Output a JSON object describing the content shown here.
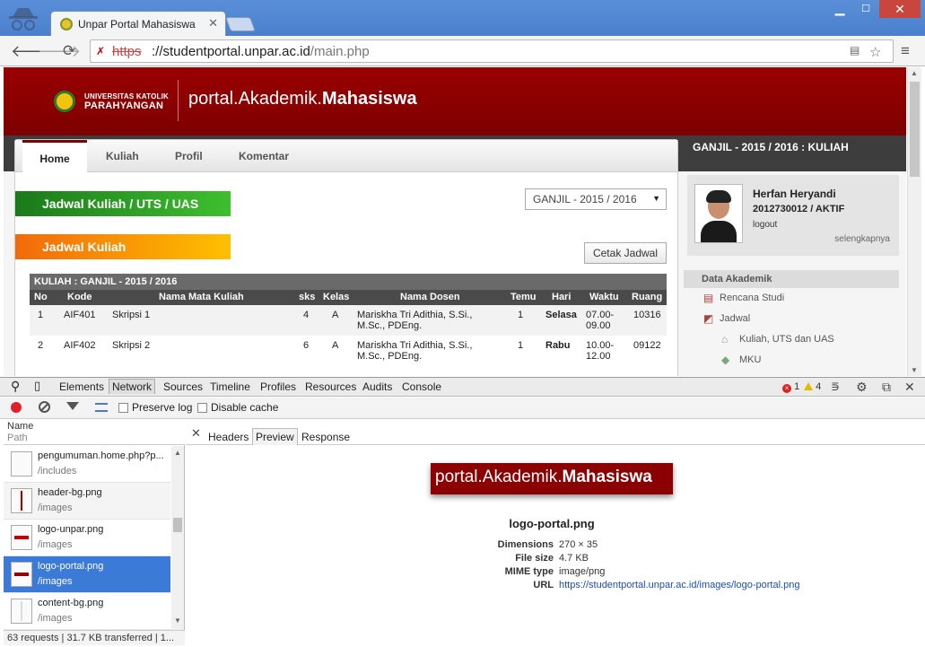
{
  "browser": {
    "tab_title": "Unpar Portal Mahasiswa",
    "url_protocol": "https",
    "url_host": "://studentportal.unpar.ac.id",
    "url_path": "/main.php"
  },
  "site": {
    "university_line1": "UNIVERSITAS KATOLIK",
    "university_line2": "PARAHYANGAN",
    "portal_title_prefix": "portal.Akademik.",
    "portal_title_bold": "Mahasiswa",
    "nav": [
      "Home",
      "Kuliah",
      "Profil",
      "Komentar"
    ],
    "section_green": "Jadwal Kuliah / UTS / UAS",
    "section_orange": "Jadwal Kuliah",
    "semester_select": "GANJIL - 2015 / 2016",
    "print_button": "Cetak Jadwal",
    "right_heading": "GANJIL - 2015 / 2016 : KULIAH",
    "schedule": {
      "caption": "KULIAH : GANJIL - 2015 / 2016",
      "columns": [
        "No",
        "Kode",
        "Nama Mata Kuliah",
        "sks",
        "Kelas",
        "Nama Dosen",
        "Temu",
        "Hari",
        "Waktu",
        "Ruang"
      ],
      "rows": [
        {
          "no": "1",
          "kode": "AIF401",
          "nama": "Skripsi 1",
          "sks": "4",
          "kelas": "A",
          "dosen1": "Mariskha Tri Adithia, S.Si.,",
          "dosen2": "M.Sc., PDEng.",
          "temu": "1",
          "hari": "Selasa",
          "waktu1": "07.00-",
          "waktu2": "09.00",
          "ruang": "10316"
        },
        {
          "no": "2",
          "kode": "AIF402",
          "nama": "Skripsi 2",
          "sks": "6",
          "kelas": "A",
          "dosen1": "Mariskha Tri Adithia, S.Si.,",
          "dosen2": "M.Sc., PDEng.",
          "temu": "1",
          "hari": "Rabu",
          "waktu1": "10.00-",
          "waktu2": "12.00",
          "ruang": "09122"
        }
      ]
    },
    "profile": {
      "name": "Herfan Heryandi",
      "id_status": "2012730012 / AKTIF",
      "logout": "logout",
      "more": "selengkapnya"
    },
    "side_menu": {
      "section": "Data Akademik",
      "items": [
        "Rencana Studi",
        "Jadwal"
      ],
      "subitems": [
        "Kuliah, UTS dan UAS",
        "MKU"
      ]
    }
  },
  "devtools": {
    "tabs": [
      "Elements",
      "Network",
      "Sources",
      "Timeline",
      "Profiles",
      "Resources",
      "Audits",
      "Console"
    ],
    "errors": "1",
    "warnings": "4",
    "preserve_log": "Preserve log",
    "disable_cache": "Disable cache",
    "col_name": "Name",
    "col_path": "Path",
    "requests": [
      {
        "name": "pengumuman.home.php?p...",
        "path": "/includes"
      },
      {
        "name": "header-bg.png",
        "path": "/images"
      },
      {
        "name": "logo-unpar.png",
        "path": "/images"
      },
      {
        "name": "logo-portal.png",
        "path": "/images"
      },
      {
        "name": "content-bg.png",
        "path": "/images"
      }
    ],
    "status": "63 requests | 31.7 KB transferred | 1...",
    "subtabs": [
      "Headers",
      "Preview",
      "Response"
    ],
    "preview": {
      "filename": "logo-portal.png",
      "keys": [
        "Dimensions",
        "File size",
        "MIME type",
        "URL"
      ],
      "dimensions": "270 × 35",
      "file_size": "4.7 KB",
      "mime": "image/png",
      "url": "https://studentportal.unpar.ac.id/images/logo-portal.png"
    }
  }
}
